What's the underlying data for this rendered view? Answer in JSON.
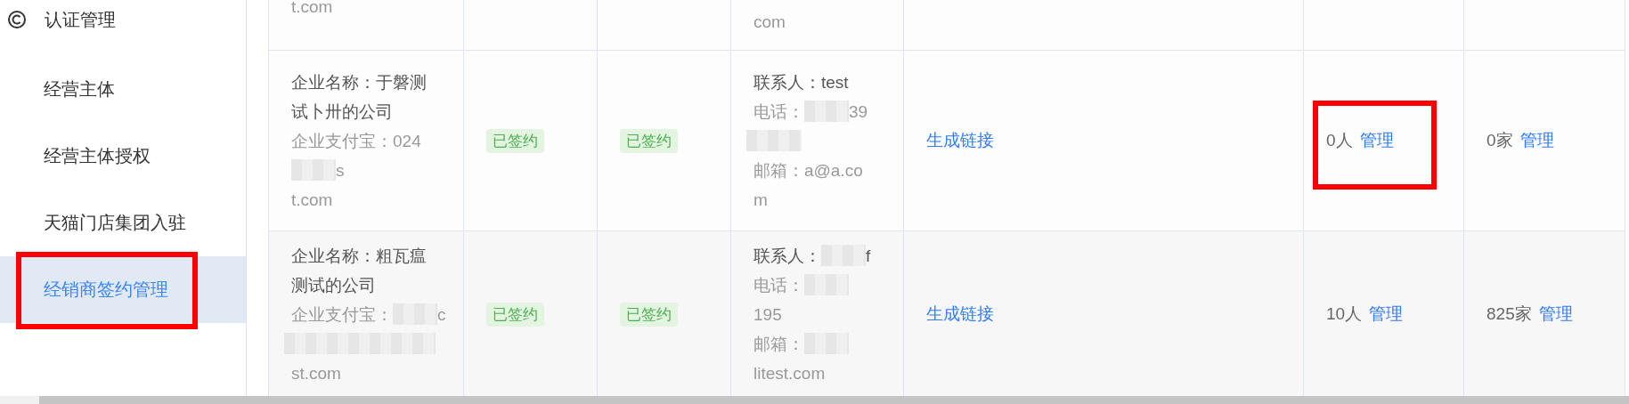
{
  "sidebar": {
    "group": {
      "label": "认证管理"
    },
    "items": [
      {
        "label": "经营主体",
        "selected": false,
        "highlighted": false
      },
      {
        "label": "经营主体授权",
        "selected": false,
        "highlighted": false
      },
      {
        "label": "天猫门店集团入驻",
        "selected": false,
        "highlighted": false
      },
      {
        "label": "经销商签约管理",
        "selected": true,
        "highlighted": true
      }
    ]
  },
  "table": {
    "rows": [
      {
        "shaded": false,
        "company": [
          {
            "kind": "secondary",
            "segments": [
              {
                "text": "t.com"
              }
            ]
          }
        ],
        "contact": [
          {
            "kind": "secondary",
            "segments": [
              {
                "text": "com"
              }
            ]
          }
        ]
      },
      {
        "shaded": false,
        "company": [
          {
            "kind": "primary",
            "segments": [
              {
                "text": "企业名称：于磐测"
              }
            ]
          },
          {
            "kind": "primary",
            "segments": [
              {
                "text": "试卜卅的公司"
              }
            ]
          },
          {
            "kind": "secondary",
            "segments": [
              {
                "text": "企业支付宝：024"
              }
            ]
          },
          {
            "kind": "secondary",
            "segments": [
              {
                "kind": "blur"
              },
              {
                "text": "s"
              }
            ]
          },
          {
            "kind": "secondary",
            "segments": [
              {
                "text": "t.com"
              }
            ]
          }
        ],
        "status_1": {
          "label": "已签约"
        },
        "status_2": {
          "label": "已签约"
        },
        "contact": [
          {
            "kind": "primary",
            "segments": [
              {
                "text": "联系人：test"
              }
            ]
          },
          {
            "kind": "secondary",
            "segments": [
              {
                "text": "电话："
              },
              {
                "kind": "blur"
              },
              {
                "text": "39"
              }
            ]
          },
          {
            "kind": "secondary",
            "segments": [
              {
                "kind": "blur"
              }
            ]
          },
          {
            "kind": "secondary",
            "segments": [
              {
                "text": "邮箱：a@a.co"
              }
            ]
          },
          {
            "kind": "secondary",
            "segments": [
              {
                "text": "m"
              }
            ]
          }
        ],
        "action": {
          "label": "生成链接"
        },
        "members": {
          "count": "0人",
          "link": "管理",
          "highlighted": true
        },
        "stores": {
          "count": "0家",
          "link": "管理",
          "highlighted": false
        }
      },
      {
        "shaded": true,
        "company": [
          {
            "kind": "primary",
            "segments": [
              {
                "text": "企业名称：粗瓦瘟"
              }
            ]
          },
          {
            "kind": "primary",
            "segments": [
              {
                "text": "测试的公司"
              }
            ]
          },
          {
            "kind": "secondary",
            "segments": [
              {
                "text": "企业支付宝："
              },
              {
                "kind": "blur"
              },
              {
                "text": "c"
              }
            ]
          },
          {
            "kind": "secondary",
            "segments": [
              {
                "kind": "blur"
              }
            ]
          },
          {
            "kind": "secondary",
            "segments": [
              {
                "text": "st.com"
              }
            ]
          }
        ],
        "status_1": {
          "label": "已签约"
        },
        "status_2": {
          "label": "已签约"
        },
        "contact": [
          {
            "kind": "primary",
            "segments": [
              {
                "text": "联系人："
              },
              {
                "kind": "blur"
              },
              {
                "text": "f"
              }
            ]
          },
          {
            "kind": "secondary",
            "segments": [
              {
                "text": "电话："
              },
              {
                "kind": "blur"
              }
            ]
          },
          {
            "kind": "secondary",
            "segments": [
              {
                "text": "195"
              }
            ]
          },
          {
            "kind": "secondary",
            "segments": [
              {
                "text": "邮箱："
              },
              {
                "kind": "blur"
              }
            ]
          },
          {
            "kind": "secondary",
            "segments": [
              {
                "text": "litest.com"
              }
            ]
          }
        ],
        "action": {
          "label": "生成链接"
        },
        "members": {
          "count": "10人",
          "link": "管理",
          "highlighted": false
        },
        "stores": {
          "count": "825家",
          "link": "管理",
          "highlighted": false
        }
      }
    ]
  }
}
